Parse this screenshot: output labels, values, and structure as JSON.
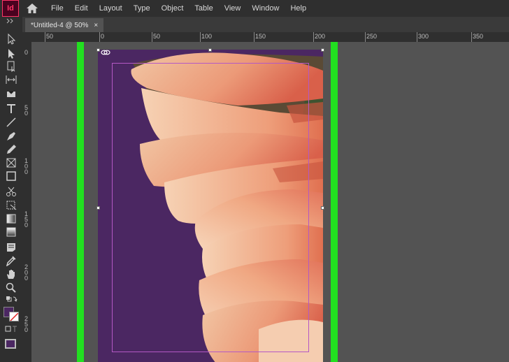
{
  "app": {
    "logo_text": "Id"
  },
  "menu": [
    "File",
    "Edit",
    "Layout",
    "Type",
    "Object",
    "Table",
    "View",
    "Window",
    "Help"
  ],
  "tab": {
    "title": "*Untitled-4 @ 50%",
    "close": "×"
  },
  "ruler": {
    "horizontal_labels": [
      "50",
      "0",
      "50",
      "100",
      "150",
      "200",
      "250",
      "300",
      "350"
    ],
    "vertical_labels": [
      "0",
      "5\n0",
      "1\n0\n0",
      "1\n5\n0",
      "2\n0\n0",
      "2\n5\n0"
    ]
  },
  "colors": {
    "accent_green": "#22e020",
    "page_fill": "#4b2762",
    "margin_guide": "#b458c5",
    "fill_swatch": "#4b2762"
  },
  "icons": {
    "home": "home-icon",
    "selection": "selection-tool-icon",
    "direct_selection": "direct-selection-tool-icon",
    "page": "page-tool-icon",
    "gap": "gap-tool-icon",
    "content_collector": "content-collector-icon",
    "type": "type-tool-icon",
    "line": "line-tool-icon",
    "pen": "pen-tool-icon",
    "pencil": "pencil-tool-icon",
    "rect_frame": "rectangle-frame-tool-icon",
    "rectangle": "rectangle-tool-icon",
    "scissors": "scissors-tool-icon",
    "free_transform": "free-transform-tool-icon",
    "gradient": "gradient-swatch-tool-icon",
    "gradient_feather": "gradient-feather-tool-icon",
    "note": "note-tool-icon",
    "eyedropper": "eyedropper-tool-icon",
    "hand": "hand-tool-icon",
    "zoom": "zoom-tool-icon",
    "swap": "swap-colors-icon",
    "default": "default-colors-icon",
    "link": "link-icon"
  }
}
